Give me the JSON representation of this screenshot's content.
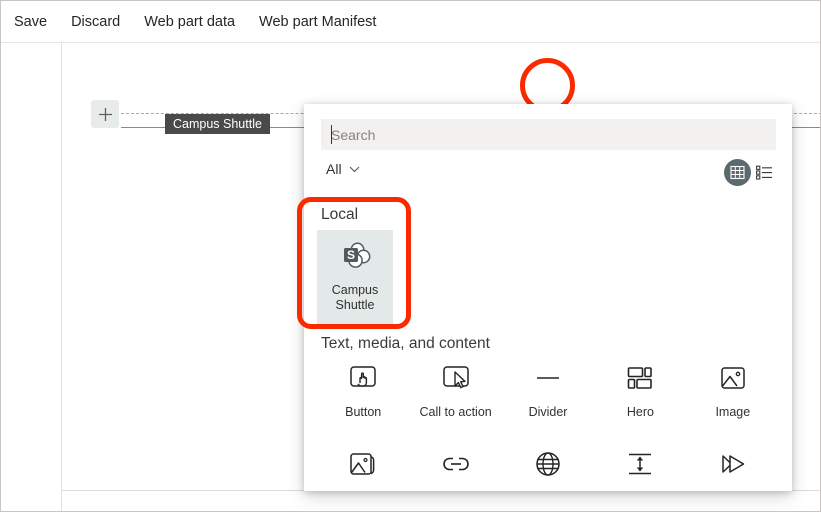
{
  "commandbar": {
    "items": [
      {
        "label": "Save",
        "name": "save"
      },
      {
        "label": "Discard",
        "name": "discard"
      },
      {
        "label": "Web part data",
        "name": "web-part-data"
      },
      {
        "label": "Web part Manifest",
        "name": "web-part-manifest"
      }
    ]
  },
  "canvas": {
    "add_section_icon": "plus-icon",
    "add_webpart_icon": "plus-icon",
    "tooltip": "Campus Shuttle"
  },
  "picker": {
    "search": {
      "placeholder": "Search",
      "value": ""
    },
    "filter": {
      "label": "All",
      "icon": "chevron-down-icon"
    },
    "view": {
      "grid_icon": "grid-view-icon",
      "list_icon": "list-view-icon",
      "active": "grid"
    },
    "sections": [
      {
        "heading": "Local",
        "items": [
          {
            "label": "Campus Shuttle",
            "icon": "sharepoint-icon"
          }
        ]
      },
      {
        "heading": "Text, media, and content",
        "items": [
          {
            "label": "Button",
            "icon": "button-hand-icon"
          },
          {
            "label": "Call to action",
            "icon": "cursor-box-icon"
          },
          {
            "label": "Divider",
            "icon": "divider-icon"
          },
          {
            "label": "Hero",
            "icon": "hero-layout-icon"
          },
          {
            "label": "Image",
            "icon": "image-icon"
          },
          {
            "label": "",
            "icon": "image-gallery-icon"
          },
          {
            "label": "",
            "icon": "link-icon"
          },
          {
            "label": "",
            "icon": "globe-embed-icon"
          },
          {
            "label": "",
            "icon": "spacer-icon"
          },
          {
            "label": "",
            "icon": "quick-links-icon"
          }
        ]
      }
    ]
  },
  "annotations": {
    "circle_color": "#fa2a00",
    "rect_color": "#fa2a00"
  }
}
